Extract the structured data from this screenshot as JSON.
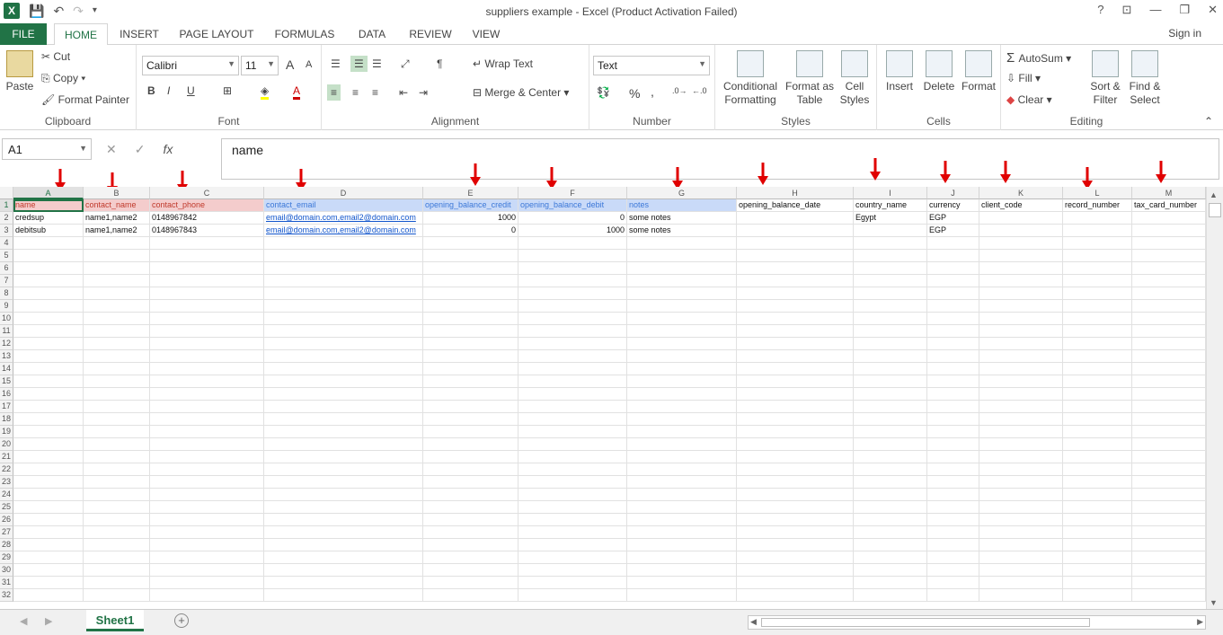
{
  "titlebar": {
    "title": "suppliers example - Excel (Product Activation Failed)",
    "help": "?",
    "minimize": "—",
    "restore": "❐",
    "close": "✕",
    "ribbon_opts": "⊡"
  },
  "tabs": {
    "file": "FILE",
    "home": "HOME",
    "insert": "INSERT",
    "page_layout": "PAGE LAYOUT",
    "formulas": "FORMULAS",
    "data": "DATA",
    "review": "REVIEW",
    "view": "VIEW",
    "signin": "Sign in"
  },
  "clipboard": {
    "paste": "Paste",
    "cut": "Cut",
    "copy": "Copy",
    "format_painter": "Format Painter",
    "label": "Clipboard"
  },
  "font": {
    "name": "Calibri",
    "size": "11",
    "label": "Font",
    "bold": "B",
    "italic": "I",
    "underline": "U",
    "grow": "A",
    "shrink": "A"
  },
  "alignment": {
    "wrap": "Wrap Text",
    "merge": "Merge & Center",
    "label": "Alignment"
  },
  "number": {
    "format": "Text",
    "percent": "%",
    "comma": ",",
    "label": "Number"
  },
  "styles": {
    "conditional": "Conditional Formatting",
    "format_table": "Format as Table",
    "cell_styles": "Cell Styles",
    "label": "Styles"
  },
  "cells": {
    "insert": "Insert",
    "delete": "Delete",
    "format": "Format",
    "label": "Cells"
  },
  "editing": {
    "autosum": "AutoSum",
    "fill": "Fill",
    "clear": "Clear",
    "sort": "Sort & Filter",
    "find": "Find & Select",
    "label": "Editing"
  },
  "formula_bar": {
    "name_box": "A1",
    "fx": "fx",
    "cancel": "✕",
    "enter": "✓",
    "value": "name"
  },
  "columns": [
    "A",
    "B",
    "C",
    "D",
    "E",
    "F",
    "G",
    "H",
    "I",
    "J",
    "K",
    "L",
    "M"
  ],
  "rows": [
    "1",
    "2",
    "3",
    "4",
    "5",
    "6",
    "7",
    "8",
    "9",
    "10",
    "11",
    "12",
    "13",
    "14",
    "15",
    "16",
    "17",
    "18",
    "19",
    "20",
    "21",
    "22",
    "23",
    "24",
    "25",
    "26",
    "27",
    "28",
    "29",
    "30",
    "31",
    "32"
  ],
  "headers": [
    "name",
    "contact_name",
    "contact_phone",
    "contact_email",
    "opening_balance_credit",
    "opening_balance_debit",
    "notes",
    "opening_balance_date",
    "country_name",
    "currency",
    "client_code",
    "record_number",
    "tax_card_number"
  ],
  "data_rows": [
    [
      "credsup",
      "name1,name2",
      "0148967842",
      "email@domain.com,email2@domain.com",
      "1000",
      "0",
      "some notes",
      "",
      "Egypt",
      "EGP",
      "",
      "",
      ""
    ],
    [
      "debitsub",
      "name1,name2",
      "0148967843",
      "email@domain.com,email2@domain.com",
      "0",
      "1000",
      "some notes",
      "",
      "",
      "EGP",
      "",
      "",
      ""
    ]
  ],
  "sheet": {
    "name": "Sheet1",
    "add": "+"
  },
  "colors": {
    "accent": "#217346",
    "pink": "#f4cccc",
    "blue": "#c9daf8",
    "arrow": "#e00000"
  }
}
